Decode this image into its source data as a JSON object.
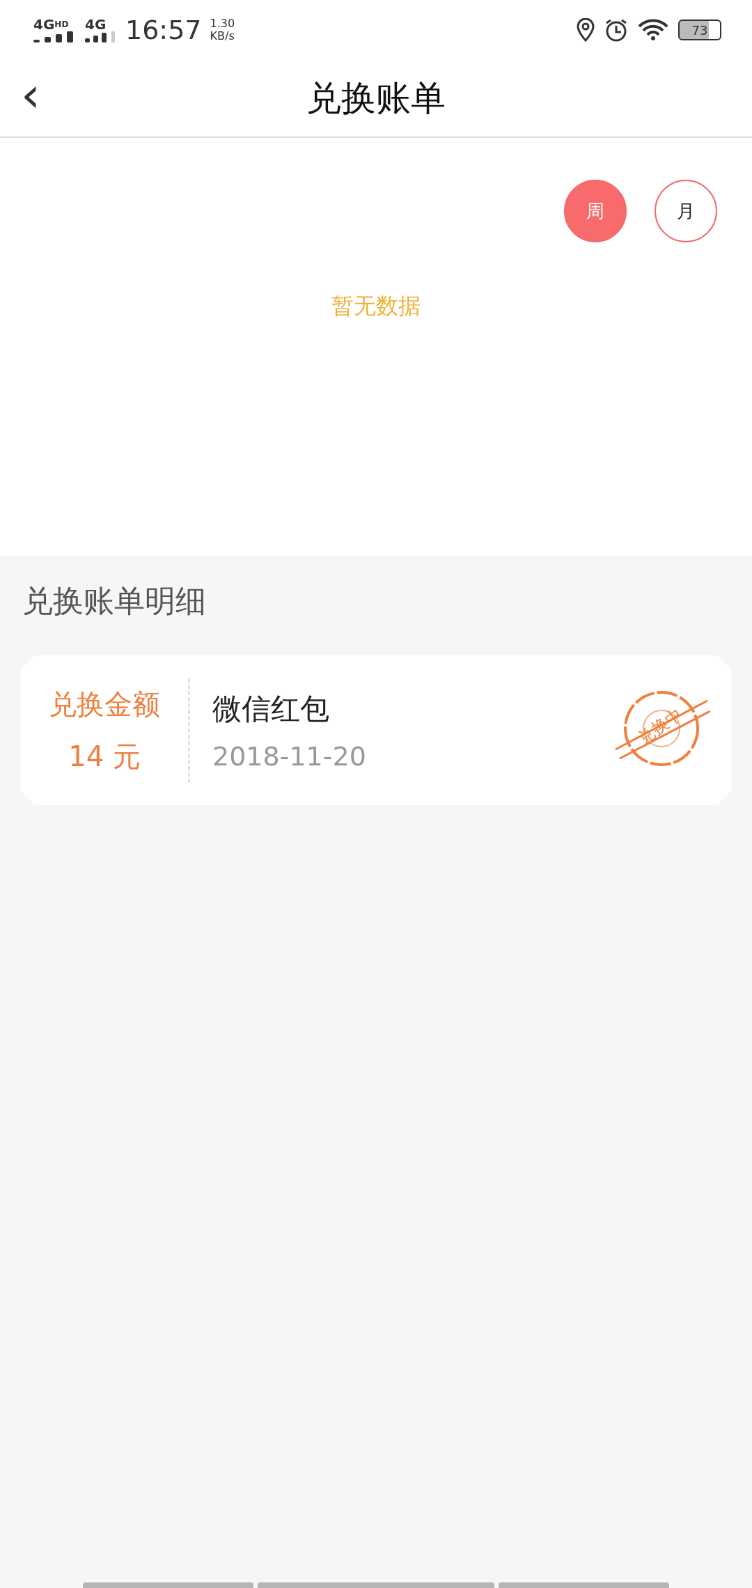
{
  "status_bar": {
    "network_1": "4G",
    "network_1_sup": "HD",
    "network_2": "4G",
    "time": "16:57",
    "speed_value": "1.30",
    "speed_unit": "KB/s",
    "battery": "73"
  },
  "header": {
    "back_icon": "‹",
    "title": "兑换账单"
  },
  "period_tabs": [
    {
      "label": "周",
      "selected": true
    },
    {
      "label": "月",
      "selected": false
    }
  ],
  "chart_empty": "暂无数据",
  "details": {
    "heading": "兑换账单明细",
    "records": [
      {
        "amount_label": "兑换金额",
        "amount": "14 元",
        "name": "微信红包",
        "date": "2018-11-20",
        "stamp": "兑换中"
      }
    ]
  }
}
